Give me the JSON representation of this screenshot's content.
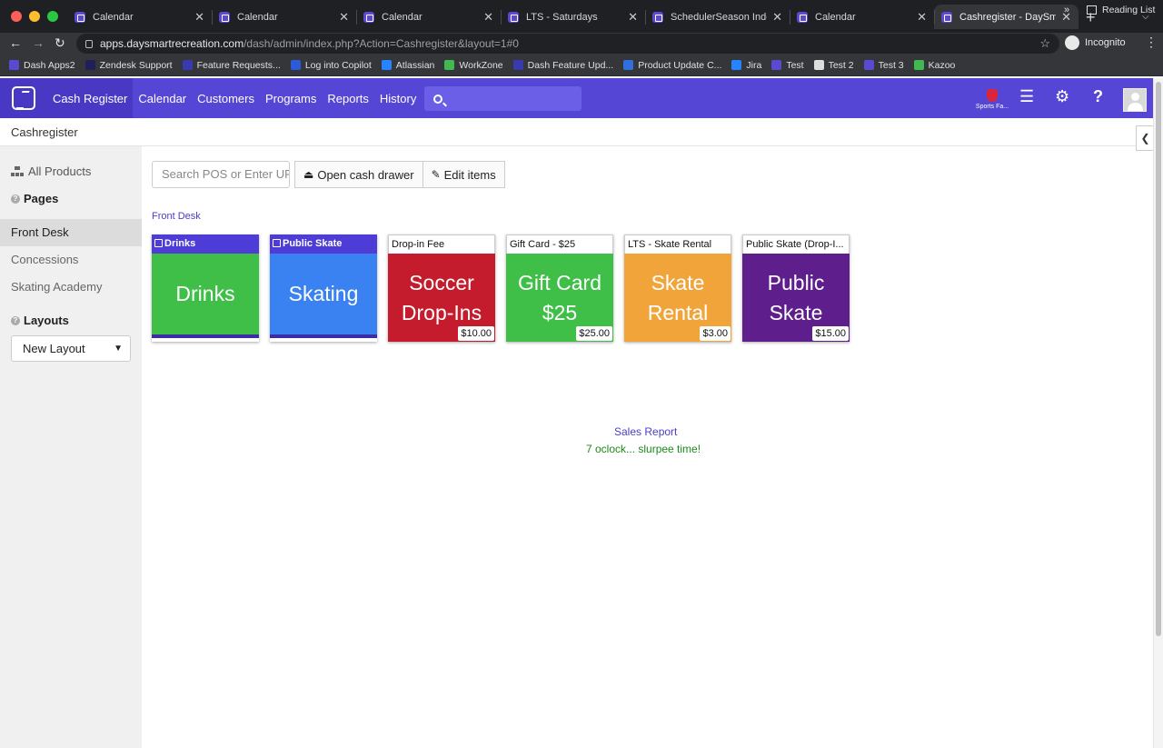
{
  "browser": {
    "tabs": [
      {
        "title": "Calendar",
        "active": false
      },
      {
        "title": "Calendar",
        "active": false
      },
      {
        "title": "Calendar",
        "active": false
      },
      {
        "title": "LTS - Saturdays",
        "active": false
      },
      {
        "title": "SchedulerSeason Index",
        "active": false
      },
      {
        "title": "Calendar",
        "active": false
      },
      {
        "title": "Cashregister - DaySmart",
        "active": true
      }
    ],
    "url_host": "apps.daysmartrecreation.com",
    "url_path": "/dash/admin/index.php?Action=Cashregister&layout=1#0",
    "profile_label": "Incognito",
    "bookmarks": [
      {
        "label": "Dash Apps2",
        "color": "#5a4ad1"
      },
      {
        "label": "Zendesk Support",
        "color": "#1f1f5a"
      },
      {
        "label": "Feature Requests...",
        "color": "#3a3ab0"
      },
      {
        "label": "Log into Copilot",
        "color": "#2b5bd9"
      },
      {
        "label": "Atlassian",
        "color": "#2684ff"
      },
      {
        "label": "WorkZone",
        "color": "#3fb950"
      },
      {
        "label": "Dash Feature Upd...",
        "color": "#3a3ab0"
      },
      {
        "label": "Product Update C...",
        "color": "#2f6fde"
      },
      {
        "label": "Jira",
        "color": "#2684ff"
      },
      {
        "label": "Test",
        "color": "#5a4ad1"
      },
      {
        "label": "Test 2",
        "color": "#dddddd"
      },
      {
        "label": "Test 3",
        "color": "#5a4ad1"
      },
      {
        "label": "Kazoo",
        "color": "#3fb950"
      }
    ],
    "bookmarks_more": "»",
    "reading_list": "Reading List"
  },
  "app": {
    "nav": [
      {
        "label": "Cash Register",
        "active": true
      },
      {
        "label": "Calendar",
        "active": false
      },
      {
        "label": "Customers",
        "active": false
      },
      {
        "label": "Programs",
        "active": false
      },
      {
        "label": "Reports",
        "active": false
      },
      {
        "label": "History",
        "active": false
      }
    ],
    "search_placeholder": "",
    "org_label": "Sports Fa...",
    "brand_color": "#5546d6"
  },
  "page": {
    "breadcrumb": "Cashregister",
    "sidebar": {
      "all_products": "All Products",
      "pages_heading": "Pages",
      "pages": [
        {
          "label": "Front Desk",
          "active": true
        },
        {
          "label": "Concessions",
          "active": false
        },
        {
          "label": "Skating Academy",
          "active": false
        }
      ],
      "layouts_heading": "Layouts",
      "layout_selected": "New Layout"
    },
    "toolbar": {
      "search_placeholder": "Search POS or Enter UPC",
      "open_drawer_label": "Open cash drawer",
      "edit_items_label": "Edit items"
    },
    "current_page_label": "Front Desk",
    "tiles": [
      {
        "caption": "Drinks",
        "label": "Drinks",
        "price": "",
        "color": "#3fbf48",
        "group": true
      },
      {
        "caption": "Public Skate",
        "label": "Skating",
        "price": "",
        "color": "#3a82f2",
        "group": true
      },
      {
        "caption": "Drop-in Fee",
        "label": "Soccer Drop-Ins",
        "price": "$10.00",
        "color": "#c41c2c",
        "group": false
      },
      {
        "caption": "Gift Card - $25",
        "label": "Gift Card $25",
        "price": "$25.00",
        "color": "#3fbf48",
        "group": false
      },
      {
        "caption": "LTS - Skate Rental",
        "label": "Skate Rental",
        "price": "$3.00",
        "color": "#f0a43a",
        "group": false
      },
      {
        "caption": "Public Skate (Drop-I...",
        "label": "Public Skate",
        "price": "$15.00",
        "color": "#5e1f8c",
        "group": false
      }
    ],
    "sales_report": "Sales Report",
    "footer_note": "7 oclock... slurpee time!"
  }
}
